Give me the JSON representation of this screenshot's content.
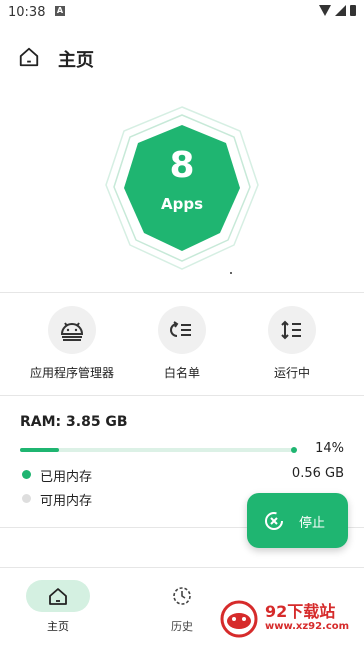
{
  "status_bar": {
    "time": "10:38",
    "notification_badge": "A"
  },
  "app_bar": {
    "title": "主页"
  },
  "hero": {
    "count": "8",
    "label": "Apps"
  },
  "actions": [
    {
      "label": "应用程序管理器",
      "icon": "android-icon"
    },
    {
      "label": "白名单",
      "icon": "whitelist-icon"
    },
    {
      "label": "运行中",
      "icon": "sort-icon"
    }
  ],
  "ram": {
    "title": "RAM: 3.85 GB",
    "percent_text": "14%",
    "percent": 14,
    "used_label": "已用内存",
    "used_value": "0.56 GB",
    "available_label": "可用内存"
  },
  "fab": {
    "label": "停止"
  },
  "bottom_nav": [
    {
      "label": "主页",
      "icon": "home-icon",
      "active": true
    },
    {
      "label": "历史",
      "icon": "history-icon",
      "active": false
    }
  ],
  "watermark": {
    "title": "92下载站",
    "url": "www.xz92.com"
  },
  "colors": {
    "accent": "#1fb571",
    "accent_light": "#dcf1e6"
  }
}
